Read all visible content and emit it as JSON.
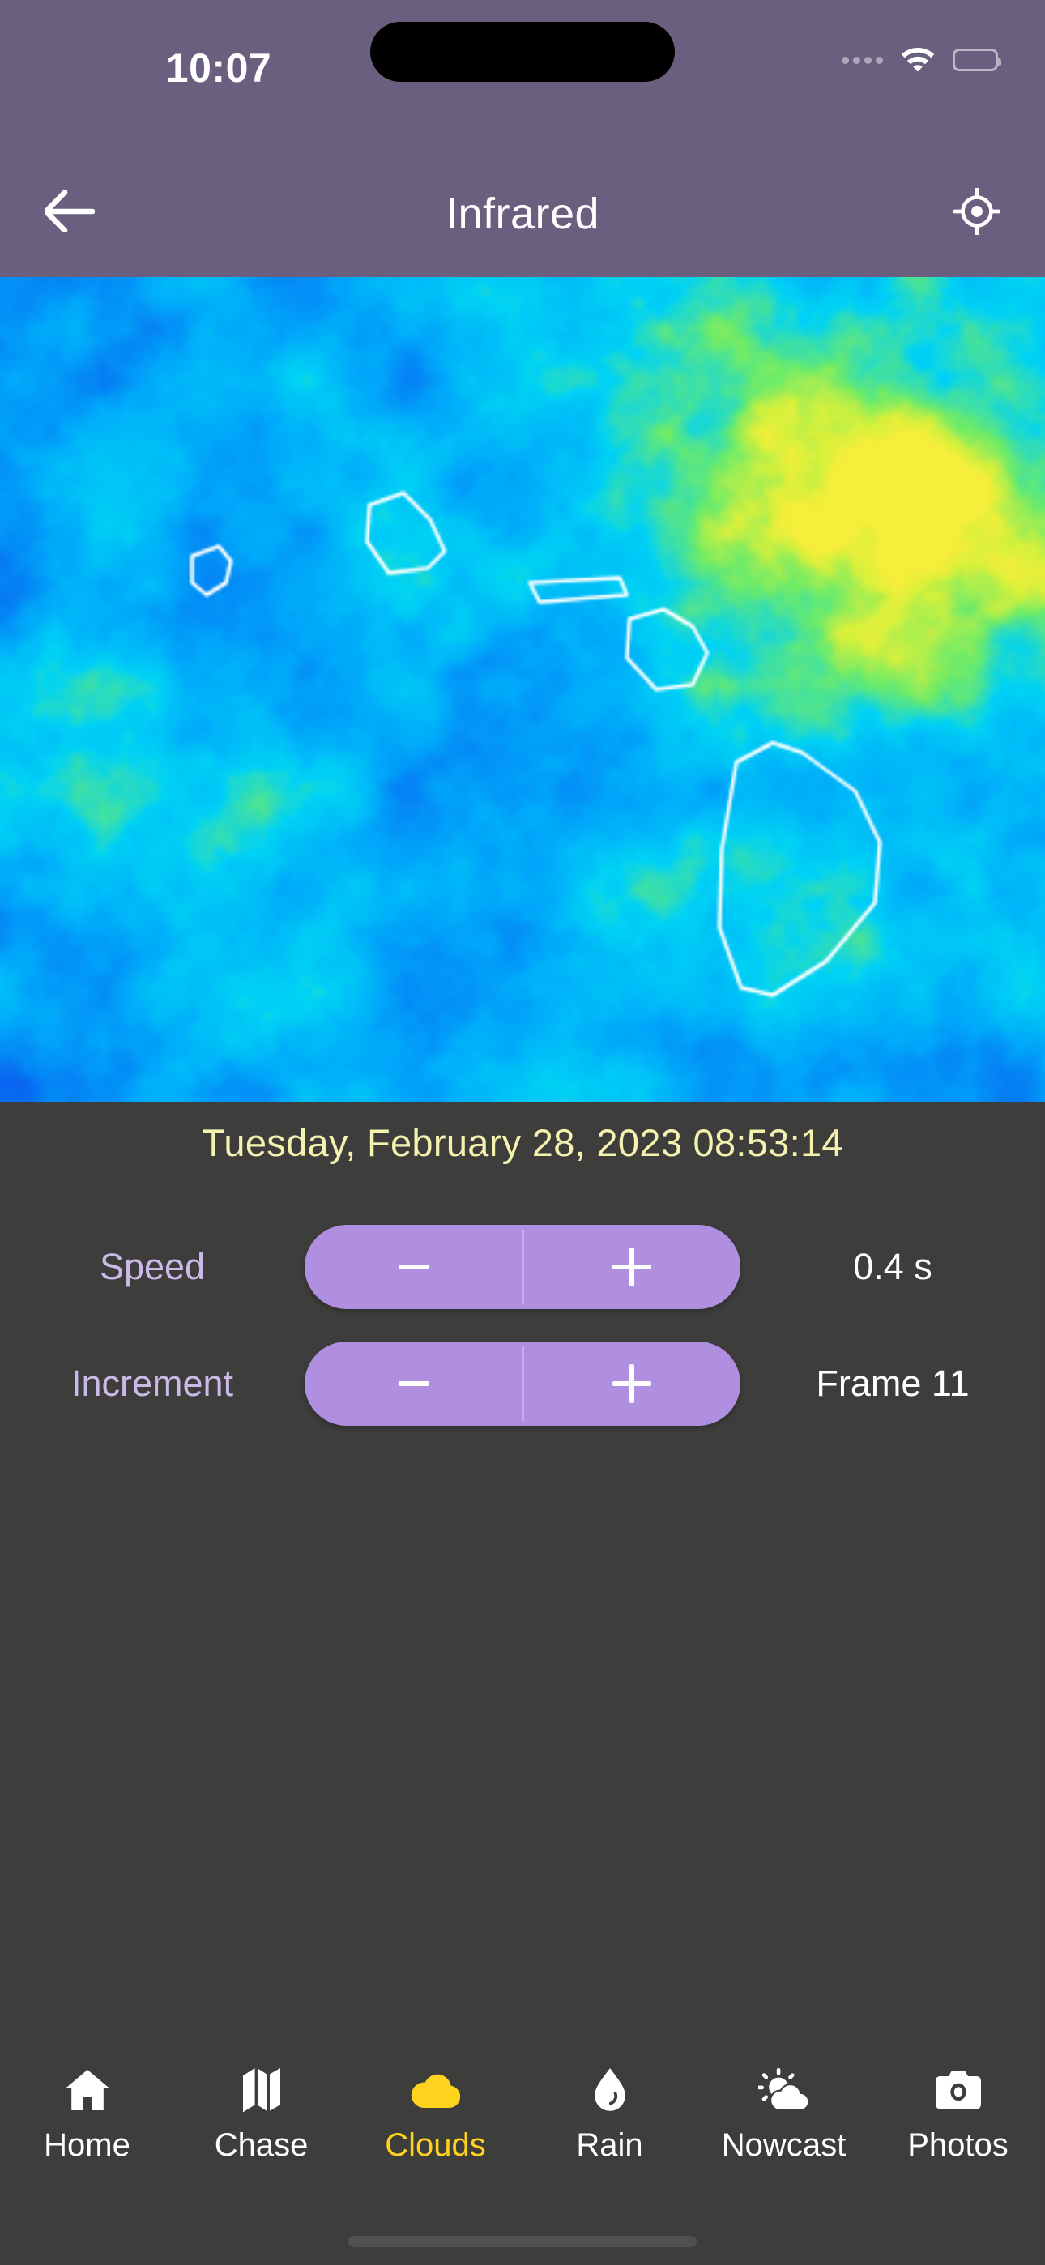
{
  "status_bar": {
    "time": "10:07",
    "signal_icon": "signal-dots-icon",
    "wifi_icon": "wifi-icon",
    "battery_icon": "battery-icon"
  },
  "nav_bar": {
    "back_icon": "back-arrow-icon",
    "title": "Infrared",
    "locate_icon": "crosshair-location-icon"
  },
  "satellite": {
    "alt": "infrared-satellite-image-hawaii",
    "region": "Hawaiian Islands",
    "palette_low": "#0a5ef0",
    "palette_mid": "#00c8ff",
    "palette_high": "#7cf03c",
    "palette_top": "#f2ef3a",
    "coastline_color": "#ffffff"
  },
  "timestamp": {
    "text": "Tuesday, February 28, 2023 08:53:14",
    "color": "#f5f2b0"
  },
  "controls": {
    "minus_label": "−",
    "plus_label": "+",
    "rows": [
      {
        "label": "Speed",
        "value": "0.4 s"
      },
      {
        "label": "Increment",
        "value": "Frame 11"
      }
    ],
    "accent": "#b18fe0",
    "label_color": "#cbb9e8"
  },
  "tab_bar": {
    "active_color": "#ffd21e",
    "items": [
      {
        "label": "Home",
        "icon": "home-icon",
        "active": false
      },
      {
        "label": "Chase",
        "icon": "map-icon",
        "active": false
      },
      {
        "label": "Clouds",
        "icon": "cloud-icon",
        "active": true
      },
      {
        "label": "Rain",
        "icon": "droplet-icon",
        "active": false
      },
      {
        "label": "Nowcast",
        "icon": "sun-cloud-icon",
        "active": false
      },
      {
        "label": "Photos",
        "icon": "camera-icon",
        "active": false
      }
    ]
  }
}
